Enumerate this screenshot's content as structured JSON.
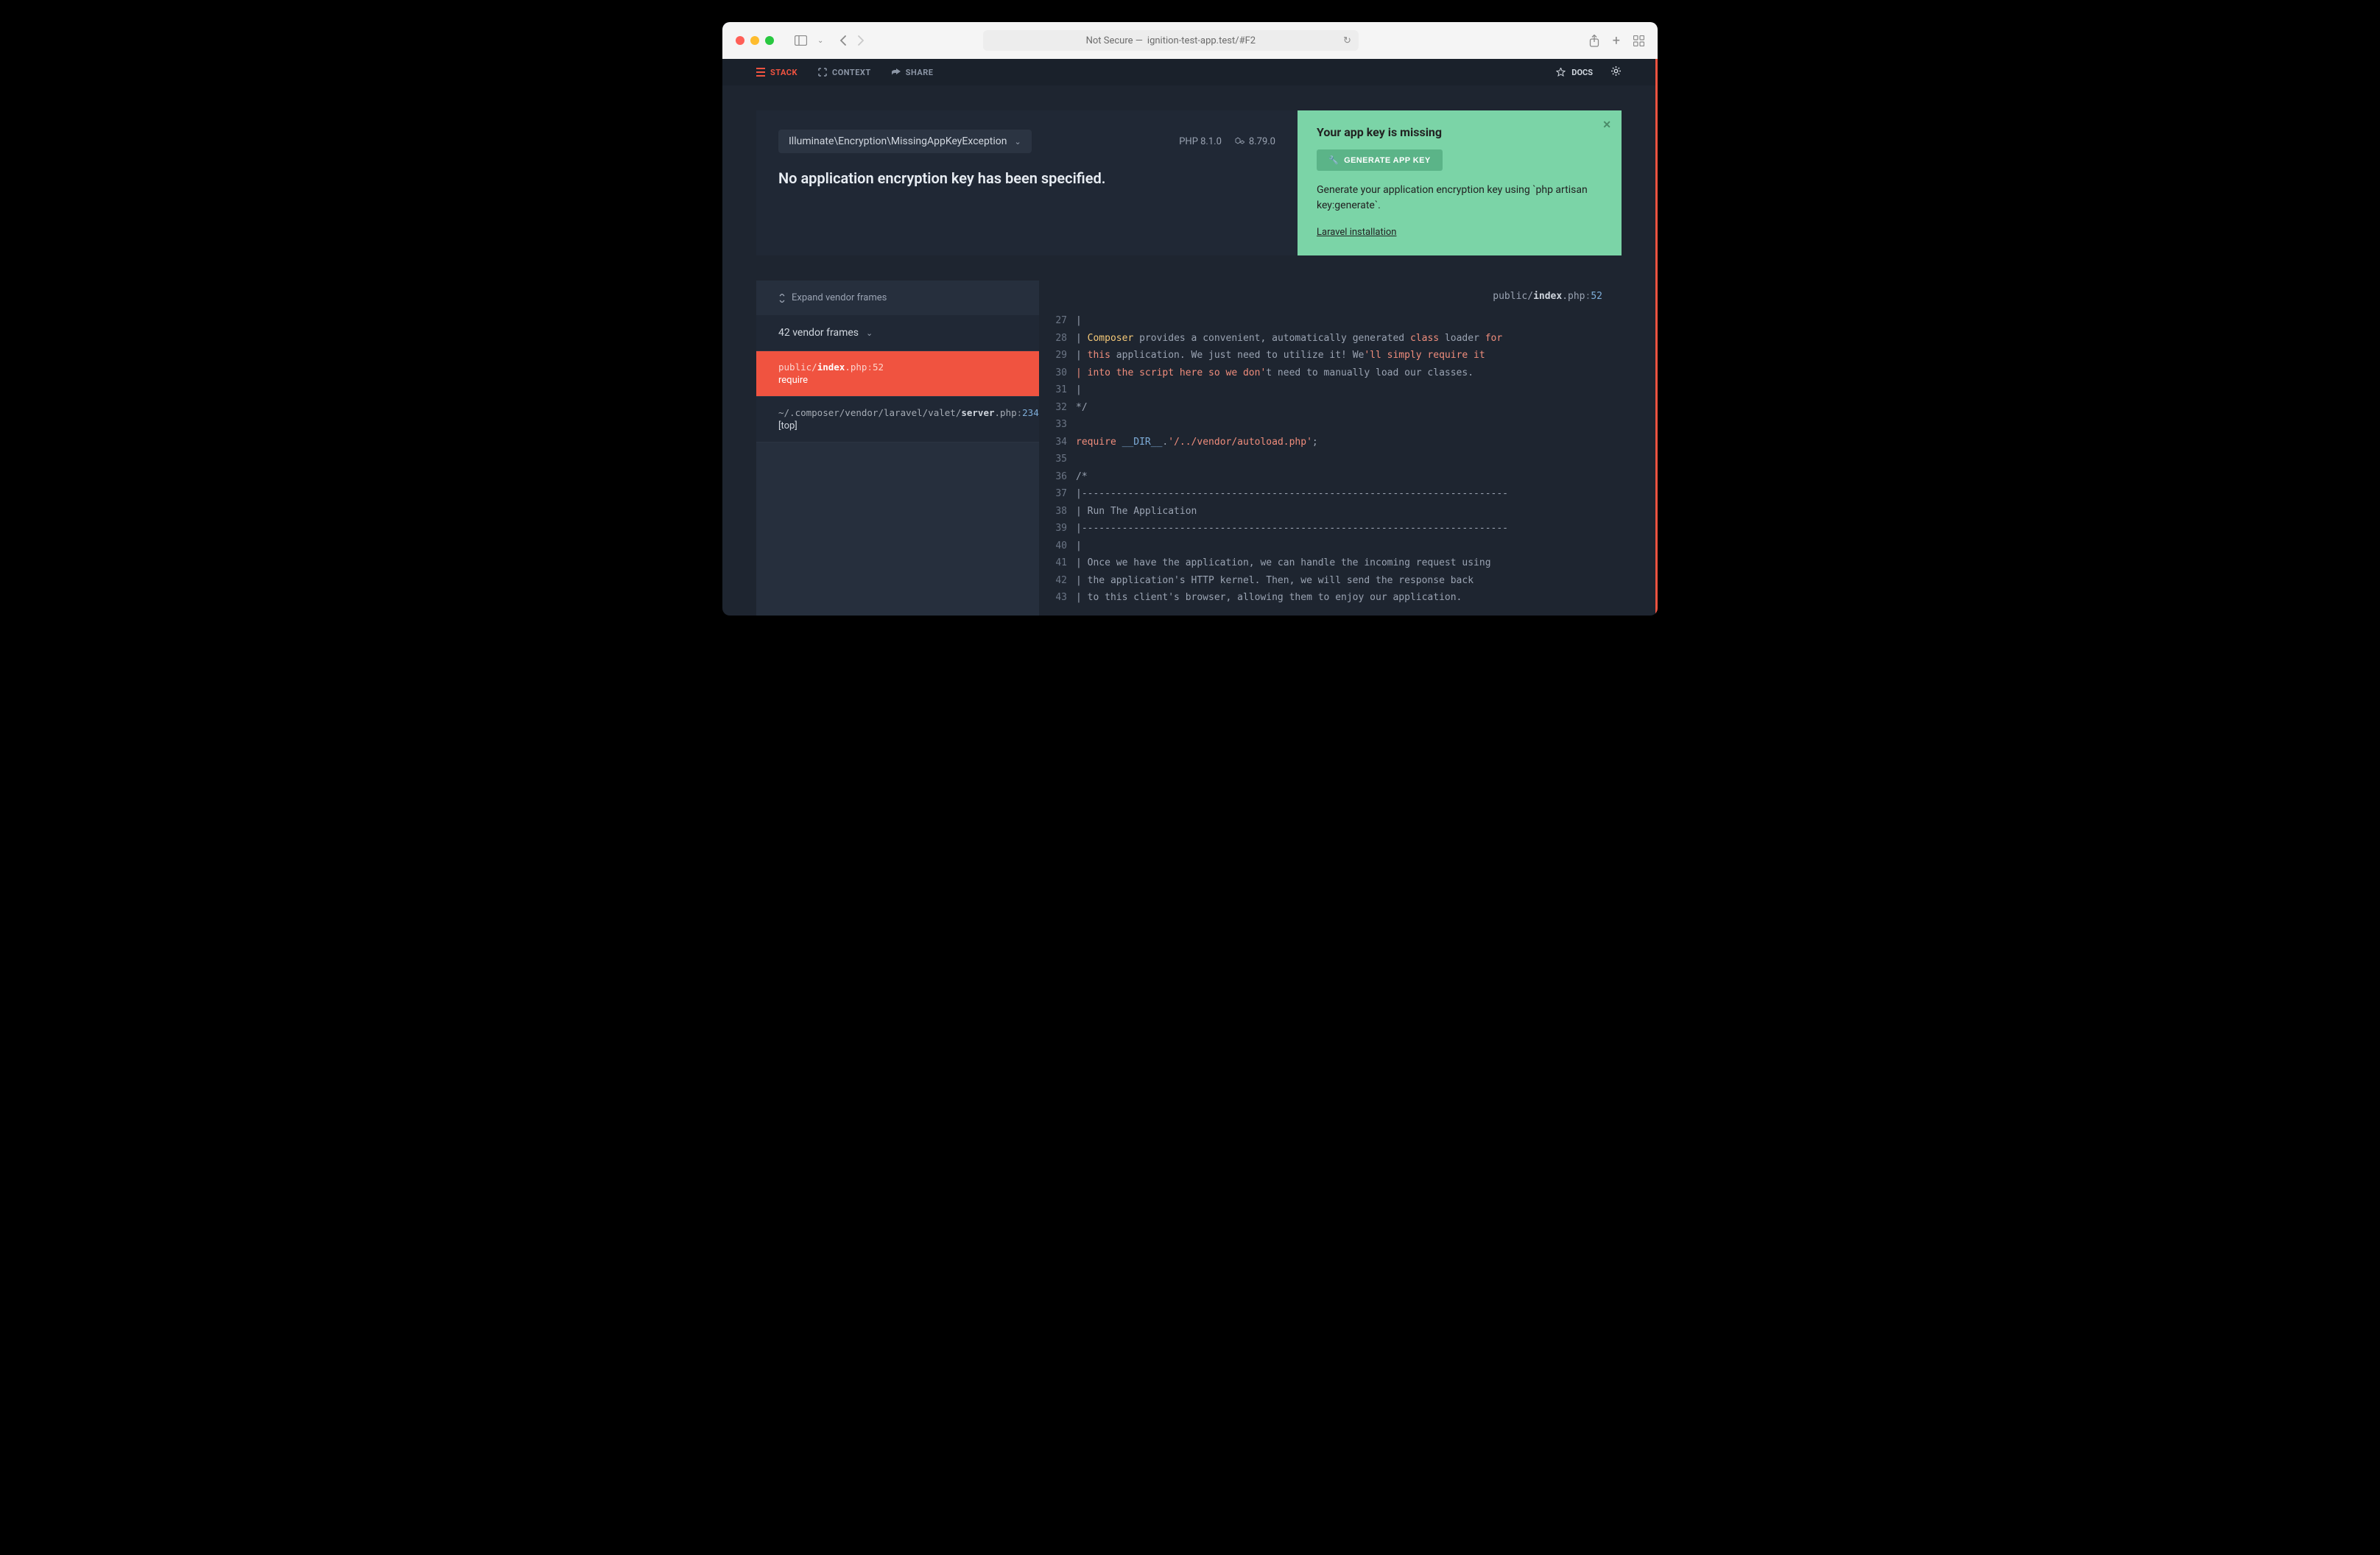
{
  "browser": {
    "url_prefix": "Not Secure —",
    "url": "ignition-test-app.test/#F2"
  },
  "nav": {
    "stack": "STACK",
    "context": "CONTEXT",
    "share": "SHARE",
    "docs": "DOCS"
  },
  "header": {
    "exception_class": "Illuminate\\Encryption\\MissingAppKeyException",
    "php_version": "PHP 8.1.0",
    "laravel_version": "8.79.0",
    "title": "No application encryption key has been specified."
  },
  "solution": {
    "title": "Your app key is missing",
    "button": "GENERATE APP KEY",
    "description": "Generate your application encryption key using `php artisan key:generate`.",
    "link": "Laravel installation"
  },
  "frames": {
    "expand": "Expand vendor frames",
    "vendor_collapse": "42 vendor frames",
    "items": [
      {
        "path_prefix": "public/",
        "path_bold": "index",
        "path_suffix": ".php",
        "line": "52",
        "fn": "require",
        "active": true
      },
      {
        "path_prefix": "~/.composer/vendor/laravel/valet/",
        "path_bold": "server",
        "path_suffix": ".php",
        "line": "234",
        "fn": "[top]",
        "active": false
      }
    ]
  },
  "code_header": {
    "prefix": "public/",
    "bold": "index",
    "suffix": ".php",
    "line": "52"
  },
  "code": {
    "start": 27,
    "lines": [
      {
        "n": 27,
        "raw": "|"
      },
      {
        "n": 28,
        "html": "| <span class='tok-cls'>Composer</span> provides a convenient, automatically generated <span class='tok-kw'>class</span> loader <span class='tok-kw'>for</span>"
      },
      {
        "n": 29,
        "html": "| <span class='tok-kw'>this</span> application. We just need to utilize it! We<span class='tok-kw'>'ll simply require it</span>"
      },
      {
        "n": 30,
        "html": "<span class='tok-kw'>| into the script here so we don'</span>t need to manually load our classes."
      },
      {
        "n": 31,
        "raw": "|"
      },
      {
        "n": 32,
        "raw": "*/"
      },
      {
        "n": 33,
        "raw": ""
      },
      {
        "n": 34,
        "html": "<span class='tok-kw'>require</span> <span class='tok-const'>__DIR__</span>.<span class='tok-kw'>'/../vendor/autoload.php'</span>;"
      },
      {
        "n": 35,
        "raw": ""
      },
      {
        "n": 36,
        "raw": "/*"
      },
      {
        "n": 37,
        "raw": "|--------------------------------------------------------------------------"
      },
      {
        "n": 38,
        "raw": "| Run The Application"
      },
      {
        "n": 39,
        "raw": "|--------------------------------------------------------------------------"
      },
      {
        "n": 40,
        "raw": "|"
      },
      {
        "n": 41,
        "raw": "| Once we have the application, we can handle the incoming request using"
      },
      {
        "n": 42,
        "raw": "| the application's HTTP kernel. Then, we will send the response back"
      },
      {
        "n": 43,
        "raw": "| to this client's browser, allowing them to enjoy our application."
      }
    ]
  }
}
